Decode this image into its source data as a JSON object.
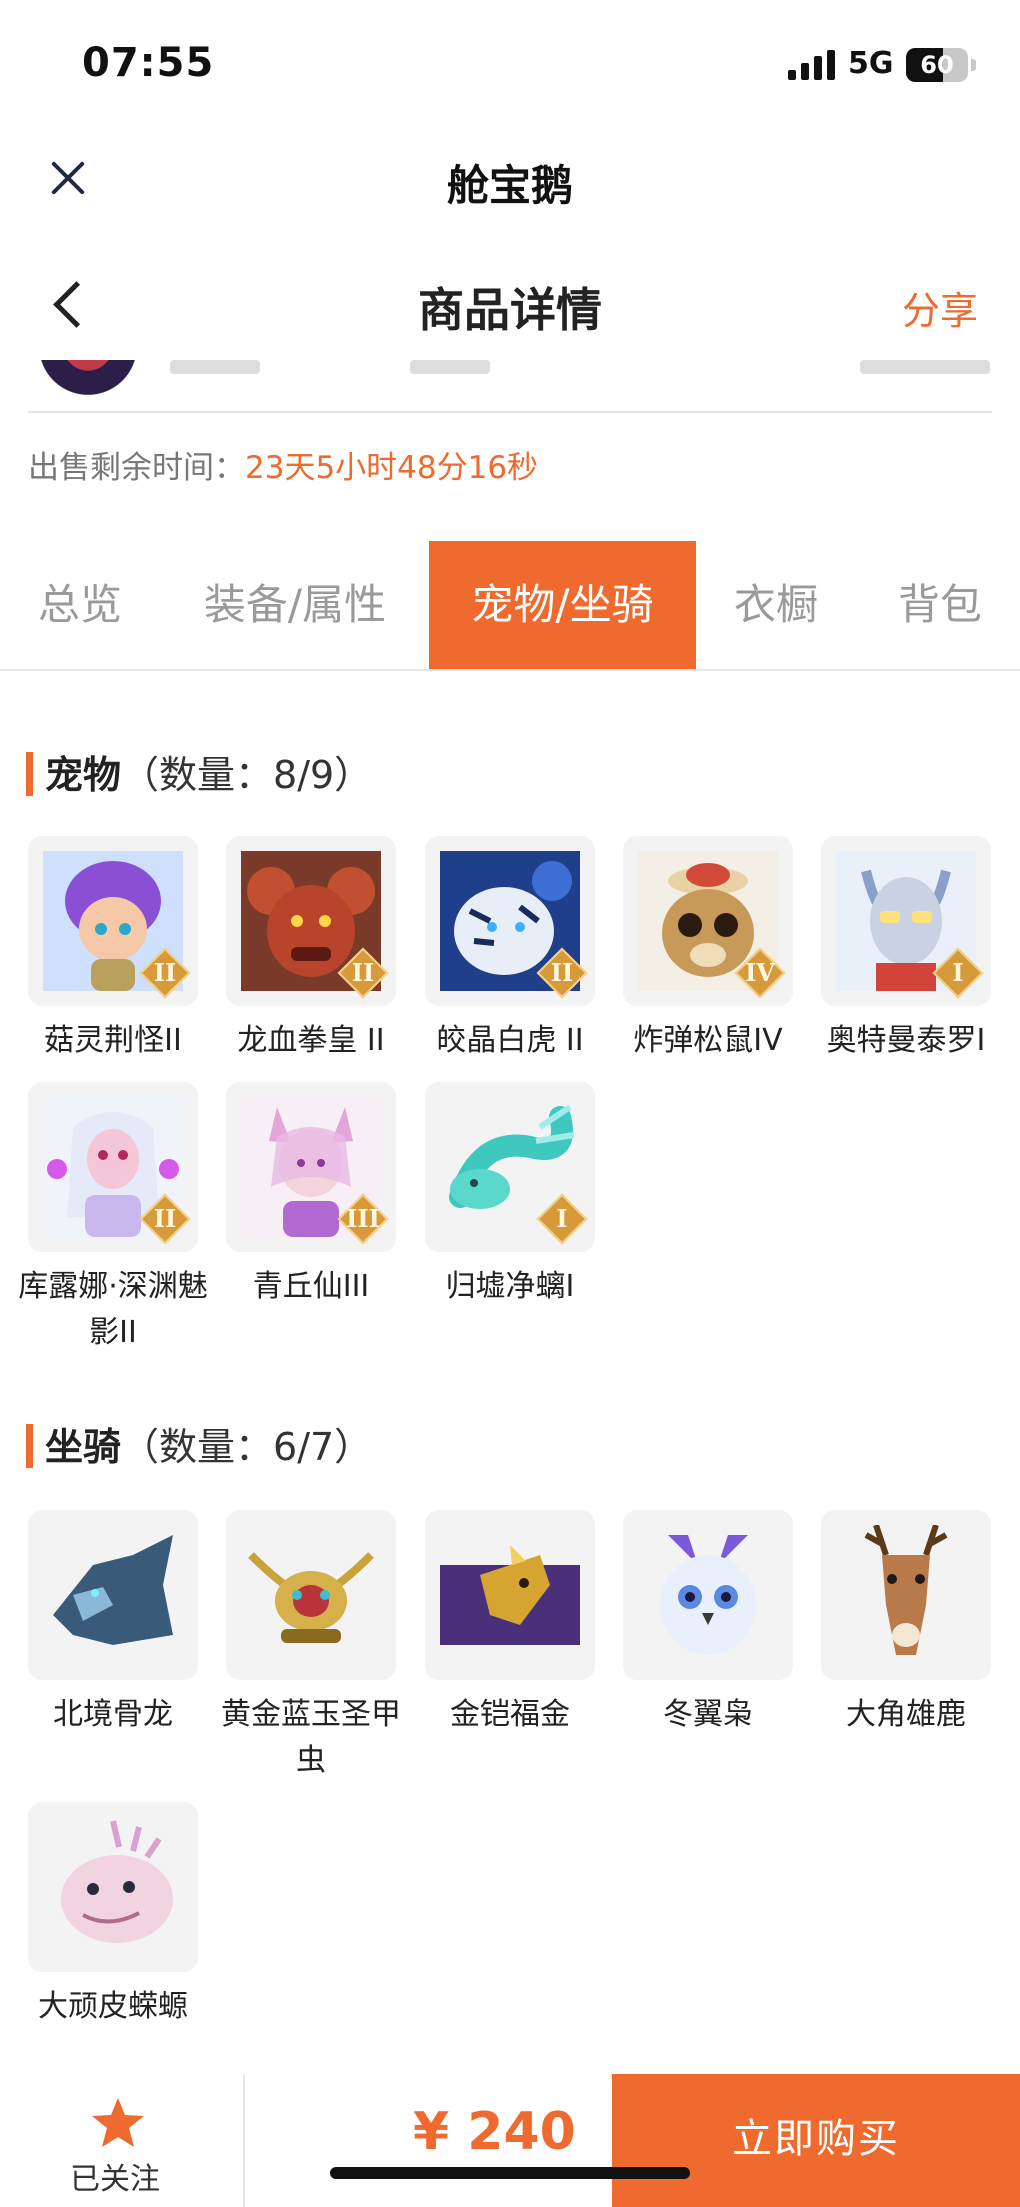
{
  "status_bar": {
    "time": "07:55",
    "network": "5G",
    "battery": "60",
    "battery_level": 0.6
  },
  "app_header": {
    "title": "舱宝鹅"
  },
  "nav": {
    "title": "商品详情",
    "share": "分享"
  },
  "sale": {
    "remaining_label": "出售剩余时间：",
    "remaining_value": "23天5小时48分16秒"
  },
  "tabs": [
    {
      "label": "总览",
      "active": false
    },
    {
      "label": "装备/属性",
      "active": false
    },
    {
      "label": "宠物/坐骑",
      "active": true
    },
    {
      "label": "衣橱",
      "active": false
    },
    {
      "label": "背包",
      "active": false
    }
  ],
  "pets": {
    "title": "宠物",
    "count": "（数量：8/9）",
    "items": [
      {
        "name": "菇灵荆怪II",
        "badge": "II",
        "icon": "purple-mushroom-pet"
      },
      {
        "name": "龙血拳皇 II",
        "badge": "II",
        "icon": "red-dragon-pet"
      },
      {
        "name": "皎晶白虎 II",
        "badge": "II",
        "icon": "white-tiger-pet"
      },
      {
        "name": "炸弹松鼠IV",
        "badge": "IV",
        "icon": "squirrel-pet"
      },
      {
        "name": "奥特曼泰罗I",
        "badge": "I",
        "icon": "ultraman-pet"
      },
      {
        "name": "库露娜·深渊魅影II",
        "badge": "II",
        "icon": "kuluna-pet"
      },
      {
        "name": "青丘仙III",
        "badge": "III",
        "icon": "fox-fairy-pet"
      },
      {
        "name": "归墟净螭I",
        "badge": "I",
        "icon": "jade-dragon-pet"
      }
    ]
  },
  "mounts": {
    "title": "坐骑",
    "count": "（数量：6/7）",
    "items": [
      {
        "name": "北境骨龙",
        "icon": "bone-dragon-mount"
      },
      {
        "name": "黄金蓝玉圣甲虫",
        "icon": "golden-scarab-mount"
      },
      {
        "name": "金铠福金",
        "icon": "golden-armor-mount"
      },
      {
        "name": "冬翼枭",
        "icon": "winter-owl-mount"
      },
      {
        "name": "大角雄鹿",
        "icon": "stag-mount"
      },
      {
        "name": "大顽皮蝾螈",
        "icon": "axolotl-mount"
      }
    ]
  },
  "bottom_bar": {
    "follow_label": "已关注",
    "price": "¥ 240",
    "buy_label": "立即购买"
  },
  "colors": {
    "accent": "#ee6a2e",
    "badge": "#d79a3a"
  }
}
